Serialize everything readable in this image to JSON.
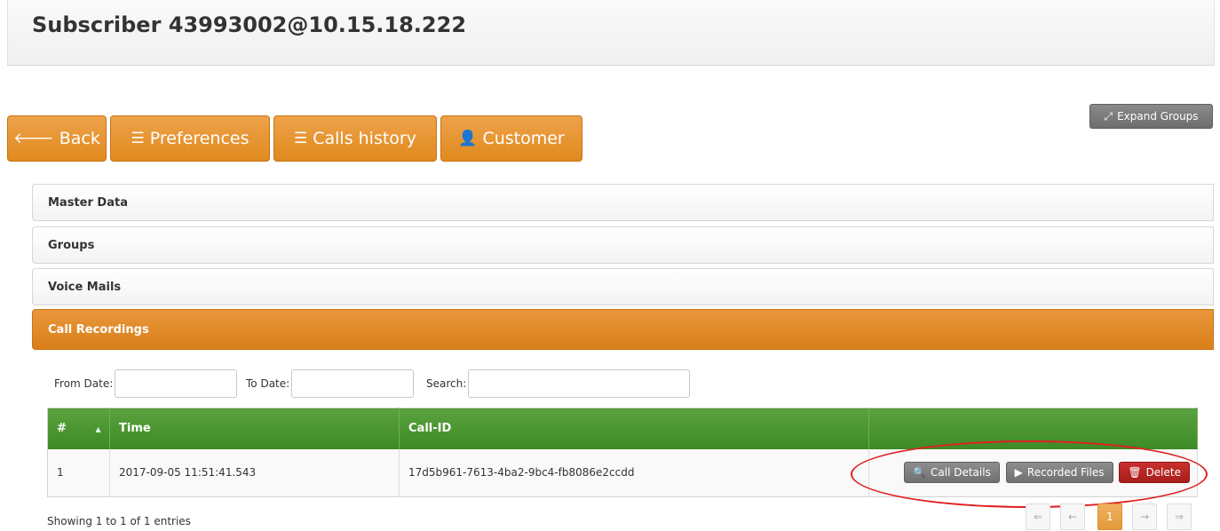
{
  "header": {
    "title": "Subscriber 43993002@10.15.18.222"
  },
  "nav": {
    "back": "Back",
    "preferences": "Preferences",
    "calls_history": "Calls history",
    "customer": "Customer"
  },
  "expand_groups": "Expand Groups",
  "sections": {
    "master_data": "Master Data",
    "groups": "Groups",
    "voice_mails": "Voice Mails",
    "call_recordings": "Call Recordings"
  },
  "filters": {
    "from_date_label": "From Date:",
    "from_date_value": "",
    "to_date_label": "To Date:",
    "to_date_value": "",
    "search_label": "Search:",
    "search_value": ""
  },
  "table": {
    "columns": [
      "#",
      "Time",
      "Call-ID",
      ""
    ],
    "rows": [
      {
        "num": "1",
        "time": "2017-09-05 11:51:41.543",
        "call_id": "17d5b961-7613-4ba2-9bc4-fb8086e2ccdd"
      }
    ],
    "actions": {
      "call_details": "Call Details",
      "recorded_files": "Recorded Files",
      "delete": "Delete"
    }
  },
  "info": "Showing 1 to 1 of 1 entries",
  "pagination": {
    "first": "⇐",
    "prev": "←",
    "current": "1",
    "next": "→",
    "last": "⇒"
  },
  "colors": {
    "accent_orange": "#e08a1e",
    "table_green": "#3d8a24",
    "delete_red": "#c9302c"
  }
}
